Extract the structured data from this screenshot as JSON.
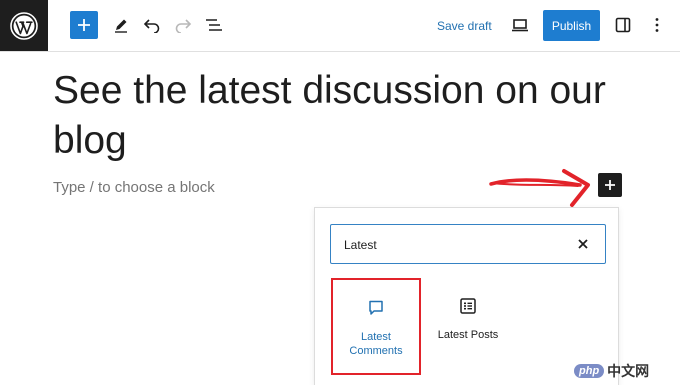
{
  "toolbar": {
    "logo_icon": "wordpress-logo-icon",
    "add_block_icon": "plus-icon",
    "tools_icon": "pencil-icon",
    "undo_icon": "undo-icon",
    "redo_icon": "redo-icon",
    "list_view_icon": "list-view-icon",
    "save_draft_label": "Save draft",
    "preview_icon": "laptop-icon",
    "publish_label": "Publish",
    "settings_icon": "sidebar-toggle-icon",
    "options_icon": "more-vertical-icon",
    "accent_color": "#1e7dd0"
  },
  "editor": {
    "title": "See the latest discussion on our blog",
    "block_placeholder": "Type / to choose a block",
    "block_inserter_icon": "plus-icon"
  },
  "inserter": {
    "search_value": "Latest",
    "clear_icon": "close-icon",
    "results": [
      {
        "label": "Latest Comments",
        "icon": "comment-icon",
        "highlighted": true
      },
      {
        "label": "Latest Posts",
        "icon": "post-list-icon",
        "highlighted": false
      }
    ]
  },
  "annotation": {
    "arrow_color": "#e2232a",
    "highlight_color": "#e2232a"
  },
  "watermark": {
    "badge": "php",
    "text": "中文网"
  }
}
